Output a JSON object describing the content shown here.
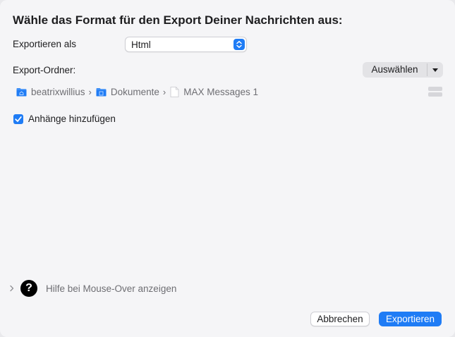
{
  "dialog": {
    "title": "Wähle das Format für den Export Deiner Nachrichten aus:"
  },
  "format": {
    "label": "Exportieren als",
    "selected": "Html"
  },
  "folder": {
    "label": "Export-Ordner:",
    "choose_label": "Auswählen",
    "path": [
      {
        "name": "beatrixwillius",
        "icon": "home-folder-icon"
      },
      {
        "name": "Dokumente",
        "icon": "documents-folder-icon"
      },
      {
        "name": "MAX Messages 1",
        "icon": "document-icon"
      }
    ]
  },
  "attachments": {
    "label": "Anhänge hinzufügen",
    "checked": true
  },
  "help": {
    "icon_glyph": "?",
    "label": "Hilfe bei Mouse-Over anzeigen"
  },
  "buttons": {
    "cancel": "Abbrechen",
    "export": "Exportieren"
  },
  "colors": {
    "accent": "#1f7cf5",
    "background": "#f5f5f7",
    "secondary_text": "#6e6e73"
  }
}
